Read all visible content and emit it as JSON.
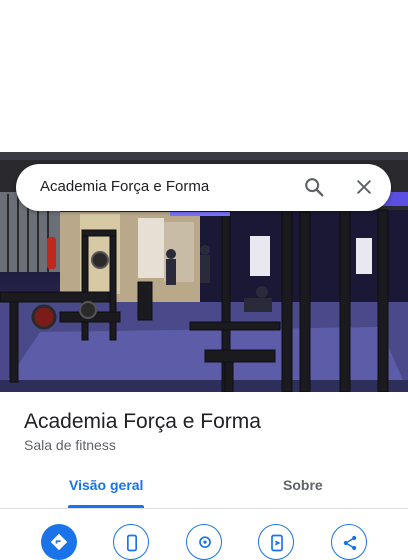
{
  "search": {
    "query": "Academia Força e Forma"
  },
  "place": {
    "name": "Academia Força e Forma",
    "category": "Sala de fitness"
  },
  "tabs": [
    {
      "label": "Visão geral",
      "active": true
    },
    {
      "label": "Sobre",
      "active": false
    }
  ],
  "actions": [
    {
      "icon": "directions-icon"
    },
    {
      "icon": "phone-icon"
    },
    {
      "icon": "location-pin-icon"
    },
    {
      "icon": "save-to-phone-icon"
    },
    {
      "icon": "share-icon"
    }
  ],
  "colors": {
    "accent": "#1a73e8",
    "text": "#202124",
    "secondary": "#5f6368"
  }
}
